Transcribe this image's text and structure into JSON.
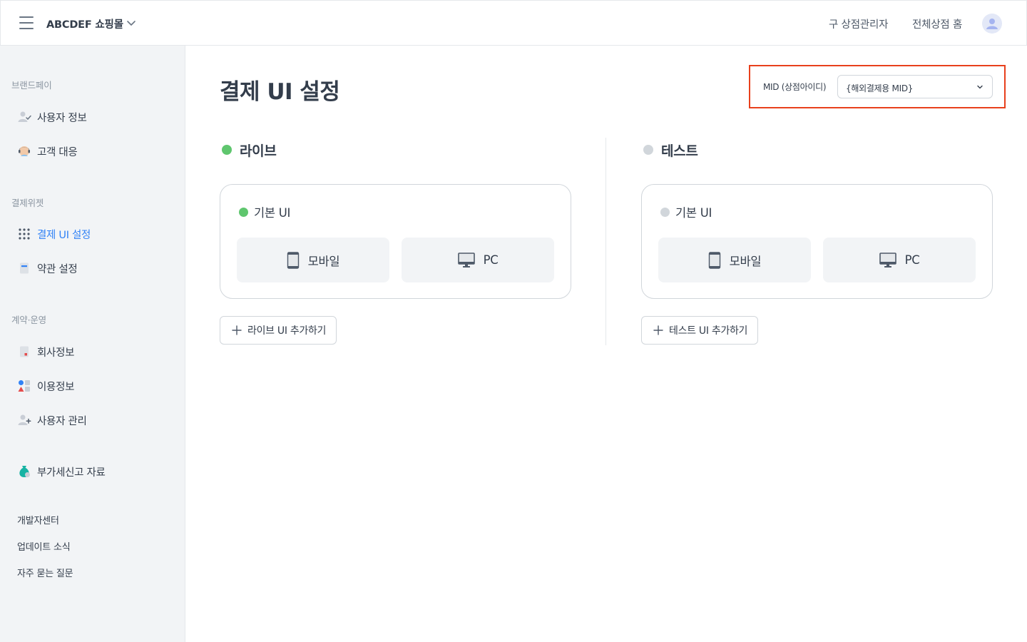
{
  "header": {
    "store_name": "ABCDEF 쇼핑몰",
    "link_old_admin": "구 상점관리자",
    "link_all_stores": "전체상점 홈"
  },
  "sidebar": {
    "section_brandpay": "브랜드페이",
    "item_user_info": "사용자 정보",
    "item_customer_support": "고객 대응",
    "section_widget": "결제위젯",
    "item_payment_ui": "결제 UI 설정",
    "item_terms": "약관 설정",
    "section_contract": "계약·운영",
    "item_company_info": "회사정보",
    "item_usage_info": "이용정보",
    "item_user_manage": "사용자 관리",
    "item_vat": "부가세신고 자료",
    "link_dev_center": "개발자센터",
    "link_updates": "업데이트 소식",
    "link_faq": "자주 묻는 질문"
  },
  "main": {
    "page_title": "결제 UI 설정",
    "mid_label": "MID (상점아이디)",
    "mid_value": "{해외결제용 MID}",
    "live": {
      "heading": "라이브",
      "card_title": "기본 UI",
      "mobile_label": "모바일",
      "pc_label": "PC",
      "add_label": "라이브 UI 추가하기"
    },
    "test": {
      "heading": "테스트",
      "card_title": "기본 UI",
      "mobile_label": "모바일",
      "pc_label": "PC",
      "add_label": "테스트 UI 추가하기"
    }
  },
  "colors": {
    "accent": "#3182f6",
    "live_dot": "#5fc66e",
    "test_dot": "#d1d6db",
    "highlight_border": "#e8401c"
  }
}
